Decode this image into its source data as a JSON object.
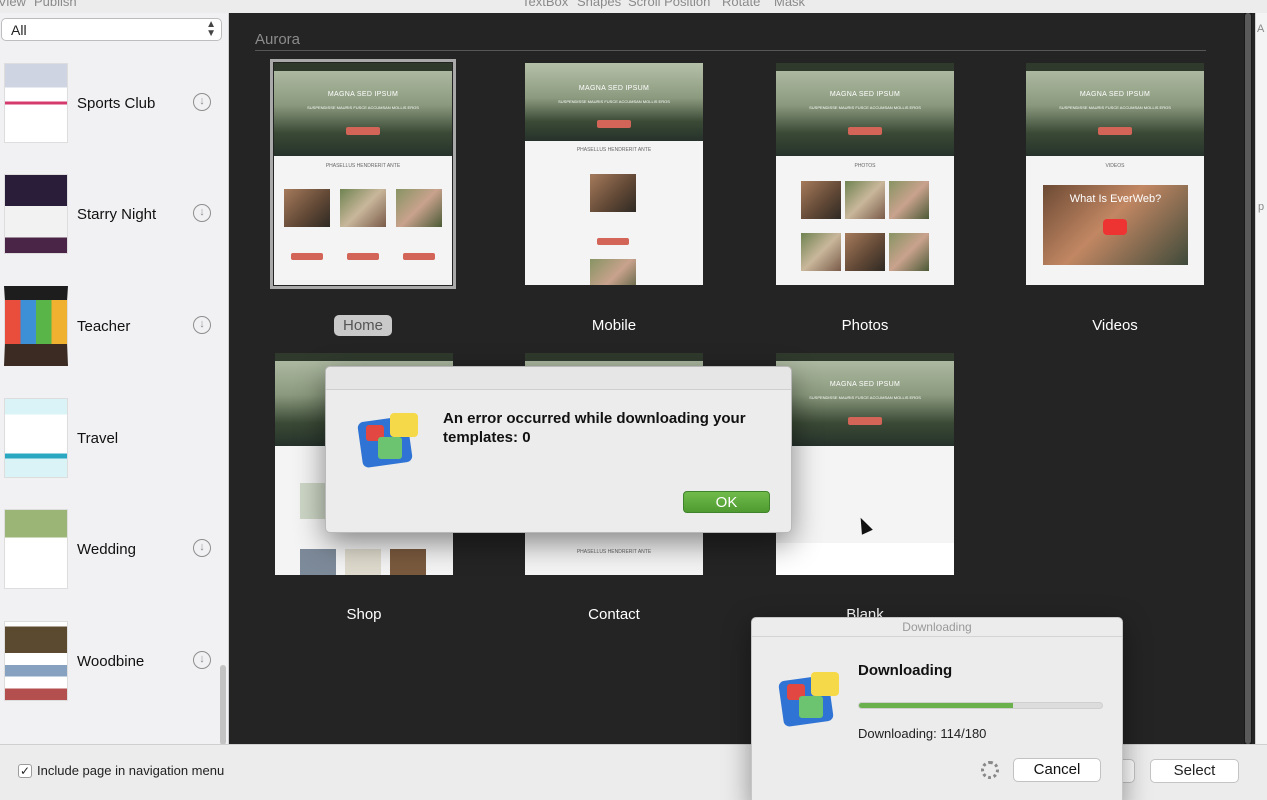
{
  "menubar": {
    "items": [
      "View",
      "Publish",
      "TextBox",
      "Shapes",
      "Scroll Position",
      "Rotate",
      "Mask"
    ]
  },
  "sidebar": {
    "filter_value": "All",
    "templates": [
      {
        "name": "Sports Club",
        "has_download": true
      },
      {
        "name": "Starry Night",
        "has_download": true
      },
      {
        "name": "Teacher",
        "has_download": true
      },
      {
        "name": "Travel",
        "has_download": false
      },
      {
        "name": "Wedding",
        "has_download": true
      },
      {
        "name": "Woodbine",
        "has_download": true
      }
    ]
  },
  "main": {
    "section_title": "Aurora",
    "thumb_text": {
      "hero_title": "MAGNA SED IPSUM",
      "hero_subtitle": "SUSPENDISSE MAURIS FUSCE ACCUMSAN MOLLIS EROS",
      "body_heading": "PHASELLUS HENDRERIT ANTE",
      "photos_heading": "PHOTOS",
      "videos_heading": "VIDEOS",
      "video_title": "What Is EverWeb?"
    },
    "pages": [
      {
        "label": "Home",
        "selected": true
      },
      {
        "label": "Mobile",
        "selected": false
      },
      {
        "label": "Photos",
        "selected": false
      },
      {
        "label": "Videos",
        "selected": false
      },
      {
        "label": "Shop",
        "selected": false
      },
      {
        "label": "Contact",
        "selected": false
      },
      {
        "label": "Blank",
        "selected": false
      }
    ]
  },
  "error_dialog": {
    "message": "An error occurred while downloading your templates: 0",
    "ok_label": "OK"
  },
  "download_window": {
    "title": "Downloading",
    "heading": "Downloading",
    "status": "Downloading: 114/180",
    "progress_fraction": 0.633,
    "cancel_label": "Cancel"
  },
  "bottom_bar": {
    "include_nav_label": "Include page in navigation menu",
    "include_nav_checked": true,
    "select_label": "Select"
  },
  "colors": {
    "accent_green": "#5aa63a",
    "main_bg": "#242424",
    "thumb_button": "#d26458"
  }
}
